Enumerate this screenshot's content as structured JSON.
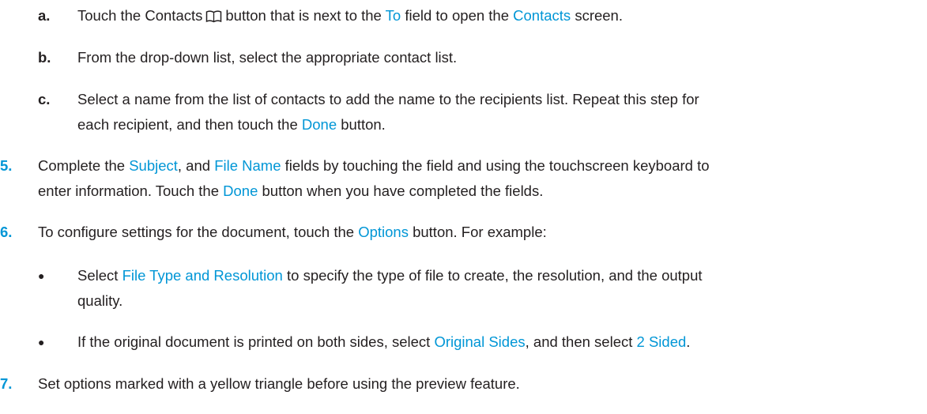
{
  "steps": {
    "a": {
      "marker": "a.",
      "t1": "Touch the Contacts",
      "t2": "button that is next to the",
      "link_to": "To",
      "t3": "field to open the",
      "link_contacts": "Contacts",
      "t4": "screen.",
      "icon": "contacts-book-icon"
    },
    "b": {
      "marker": "b.",
      "text": "From the drop-down list, select the appropriate contact list."
    },
    "c": {
      "marker": "c.",
      "line1": "Select a name from the list of contacts to add the name to the recipients list. Repeat this step for",
      "line2_pre": "each recipient, and then touch the",
      "link_done": "Done",
      "line2_post": "button."
    },
    "s5": {
      "marker": "5.",
      "t1": "Complete the",
      "link_subject": "Subject",
      "t2": ", and",
      "link_filename": "File Name",
      "t3": "fields by touching the field and using the touchscreen keyboard to",
      "l2a": "enter information. Touch the",
      "link_done": "Done",
      "l2b": "button when you have completed the fields."
    },
    "s6": {
      "marker": "6.",
      "t1": "To configure settings for the document, touch the",
      "link_options": "Options",
      "t2": "button. For example:"
    },
    "bullet1": {
      "marker": "●",
      "t1": "Select",
      "link": "File Type and Resolution",
      "t2": "to specify the type of file to create, the resolution, and the output",
      "line2": "quality."
    },
    "bullet2": {
      "marker": "●",
      "t1": "If the original document is printed on both sides, select",
      "link1": "Original Sides",
      "t2": ", and then select",
      "link2": "2 Sided",
      "t3": "."
    },
    "s7": {
      "marker": "7.",
      "text": "Set options marked with a yellow triangle before using the preview feature."
    }
  }
}
